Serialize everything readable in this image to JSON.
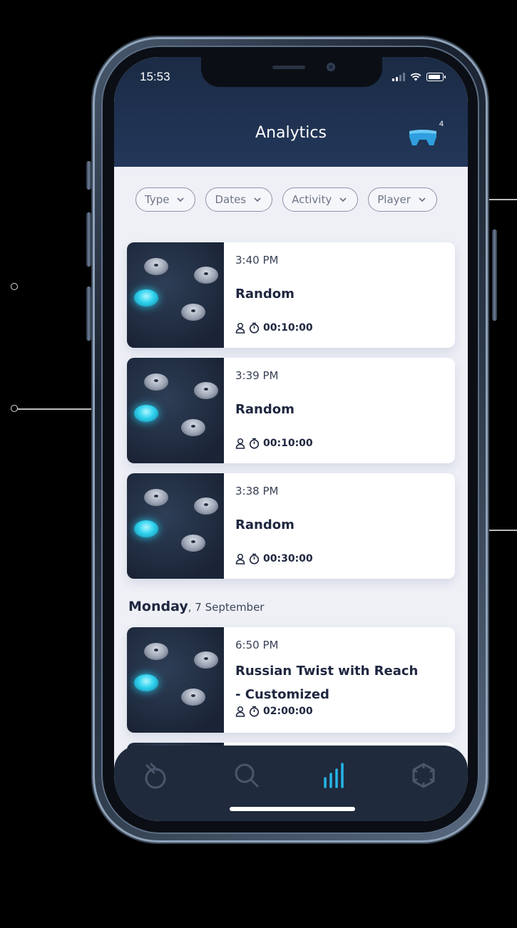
{
  "status_bar": {
    "time": "15:53"
  },
  "header": {
    "title": "Analytics",
    "device_count": "4"
  },
  "filters": [
    {
      "label": "Type"
    },
    {
      "label": "Dates"
    },
    {
      "label": "Activity"
    },
    {
      "label": "Player"
    }
  ],
  "sessions": [
    {
      "time": "3:40 PM",
      "name": "Random",
      "duration": "00:10:00"
    },
    {
      "time": "3:39 PM",
      "name": "Random",
      "duration": "00:10:00"
    },
    {
      "time": "3:38 PM",
      "name": "Random",
      "duration": "00:30:00"
    }
  ],
  "section": {
    "day": "Monday",
    "date": ", 7 September"
  },
  "section_sessions": [
    {
      "time": "6:50 PM",
      "name_line1": "Russian Twist with Reach",
      "name_line2": "- Customized",
      "duration": "02:00:00"
    }
  ],
  "tabbar": {
    "items": [
      "workouts",
      "search",
      "analytics",
      "settings"
    ],
    "active": "analytics"
  },
  "colors": {
    "accent": "#2fd2ee",
    "header": "#1b2b45",
    "active_tab": "#27b4e6"
  }
}
